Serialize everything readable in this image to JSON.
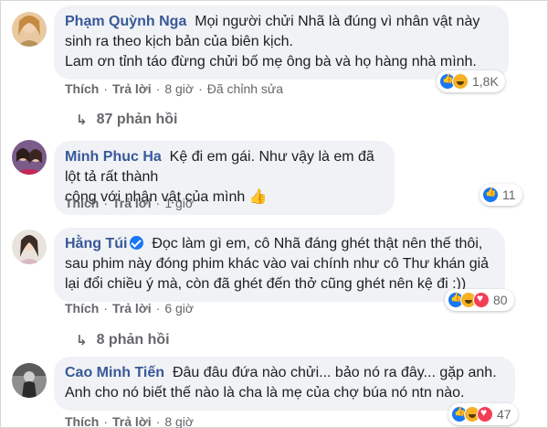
{
  "comments": [
    {
      "name": "Phạm Quỳnh Nga",
      "lines": [
        "Mọi người chửi Nhã là đúng vì nhân vật này",
        "sinh ra theo kịch bản của biên kịch.",
        "Lam ơn tỉnh táo đừng chửi bố mẹ ông bà và họ hàng nhà mình."
      ],
      "actions": [
        "Thích",
        "Trả lời",
        "8 giờ",
        "Đã chỉnh sửa"
      ],
      "reaction_icons": [
        "like-icon",
        "haha-icon"
      ],
      "reaction_count": "1,8K",
      "replies": "87 phản hồi"
    },
    {
      "name": "Minh Phuc Ha",
      "lines": [
        "Kệ đi em gái. Như vậy là em đã lột tả rất thành",
        "công với nhân vật của mình 👍"
      ],
      "actions": [
        "Thích",
        "Trả lời",
        "1 giờ"
      ],
      "reaction_icons": [
        "like-icon"
      ],
      "reaction_count": "11"
    },
    {
      "name": "Hằng Túi",
      "verified": true,
      "lines": [
        "Đọc làm gì em, cô Nhã đáng ghét thật nên thế thôi,",
        "sau phim này đóng phim khác vào vai chính như cô Thư khán giả",
        "lại đổi chiều ý mà, còn đã ghét đến thở cũng ghét nên kệ đi :))"
      ],
      "actions": [
        "Thích",
        "Trả lời",
        "6 giờ"
      ],
      "reaction_icons": [
        "like-icon",
        "haha-icon",
        "love-icon"
      ],
      "reaction_count": "80",
      "replies": "8 phản hồi"
    },
    {
      "name": "Cao Minh Tiến",
      "lines": [
        "Đâu đâu đứa nào chửi... bảo nó ra đây... gặp anh.",
        "Anh cho nó biết thế nào là cha là mẹ của chợ búa nó ntn nào."
      ],
      "actions": [
        "Thích",
        "Trả lời",
        "8 giờ"
      ],
      "reaction_icons": [
        "like-icon",
        "haha-icon",
        "love-icon"
      ],
      "reaction_count": "47"
    }
  ],
  "colors": {
    "name": "#385898",
    "bubble": "#f0f2f5",
    "meta": "#65676b",
    "like": "#1877f2",
    "haha": "#f7b125",
    "love": "#f33e58"
  }
}
